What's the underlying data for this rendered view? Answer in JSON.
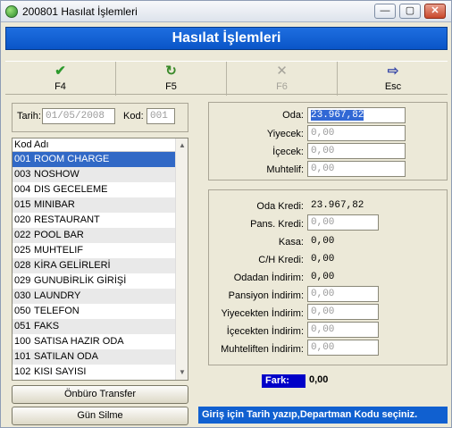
{
  "window": {
    "title": "200801 Hasılat İşlemleri",
    "minimize": "—",
    "maximize": "▢",
    "close": "✕"
  },
  "header": {
    "title": "Hasılat İşlemleri"
  },
  "toolbar": [
    {
      "key": "F4",
      "icon": "✔",
      "icon_name": "check-icon",
      "color": "#2e9a2e",
      "enabled": true
    },
    {
      "key": "F5",
      "icon": "↻",
      "icon_name": "refresh-icon",
      "color": "#3a8a2a",
      "enabled": true
    },
    {
      "key": "F6",
      "icon": "✕",
      "icon_name": "cancel-icon",
      "color": "#9a9890",
      "enabled": false
    },
    {
      "key": "Esc",
      "icon": "⇨",
      "icon_name": "exit-door-icon",
      "color": "#3a4aa8",
      "enabled": true
    }
  ],
  "filter": {
    "tarih_label": "Tarih:",
    "tarih_value": "01/05/2008",
    "kod_label": "Kod:",
    "kod_value": "001"
  },
  "list": {
    "header": "Kod Adı",
    "rows": [
      {
        "kod": "001",
        "ad": "ROOM CHARGE",
        "selected": true
      },
      {
        "kod": "003",
        "ad": "NOSHOW"
      },
      {
        "kod": "004",
        "ad": "DIS GECELEME"
      },
      {
        "kod": "015",
        "ad": "MINIBAR"
      },
      {
        "kod": "020",
        "ad": "RESTAURANT"
      },
      {
        "kod": "022",
        "ad": "POOL BAR"
      },
      {
        "kod": "025",
        "ad": "MUHTELIF"
      },
      {
        "kod": "028",
        "ad": "KİRA GELİRLERİ"
      },
      {
        "kod": "029",
        "ad": "GUNUBİRLİK GİRİŞİ"
      },
      {
        "kod": "030",
        "ad": "LAUNDRY"
      },
      {
        "kod": "050",
        "ad": "TELEFON"
      },
      {
        "kod": "051",
        "ad": "FAKS"
      },
      {
        "kod": "100",
        "ad": "SATISA HAZIR ODA"
      },
      {
        "kod": "101",
        "ad": "SATILAN ODA"
      },
      {
        "kod": "102",
        "ad": "KISI SAYISI"
      }
    ]
  },
  "buttons": {
    "onburo_transfer": "Önbüro Transfer",
    "gun_silme": "Gün Silme"
  },
  "revenue": {
    "oda": {
      "label": "Oda:",
      "value": "23.967,82"
    },
    "yiyecek": {
      "label": "Yiyecek:",
      "value": "0,00"
    },
    "icecek": {
      "label": "İçecek:",
      "value": "0,00"
    },
    "muhtelif": {
      "label": "Muhtelif:",
      "value": "0,00"
    }
  },
  "credits": {
    "oda_kredi": {
      "label": "Oda Kredi:",
      "value": "23.967,82"
    },
    "pans_kredi": {
      "label": "Pans. Kredi:",
      "value": "0,00"
    },
    "kasa": {
      "label": "Kasa:",
      "value": "0,00"
    },
    "ch_kredi": {
      "label": "C/H Kredi:",
      "value": "0,00"
    },
    "odadan_indirim": {
      "label": "Odadan İndirim:",
      "value": "0,00"
    },
    "pansiyon_indirim": {
      "label": "Pansiyon İndirim:",
      "value": "0,00"
    },
    "yiyecekten_indirim": {
      "label": "Yiyecekten İndirim:",
      "value": "0,00"
    },
    "icecekten_indirim": {
      "label": "İçecekten İndirim:",
      "value": "0,00"
    },
    "muhteliften_indirim": {
      "label": "Muhteliften İndirim:",
      "value": "0,00"
    }
  },
  "fark": {
    "label": "Fark:",
    "value": "0,00"
  },
  "status": {
    "message": "Giriş için Tarih yazıp,Departman Kodu seçiniz."
  }
}
